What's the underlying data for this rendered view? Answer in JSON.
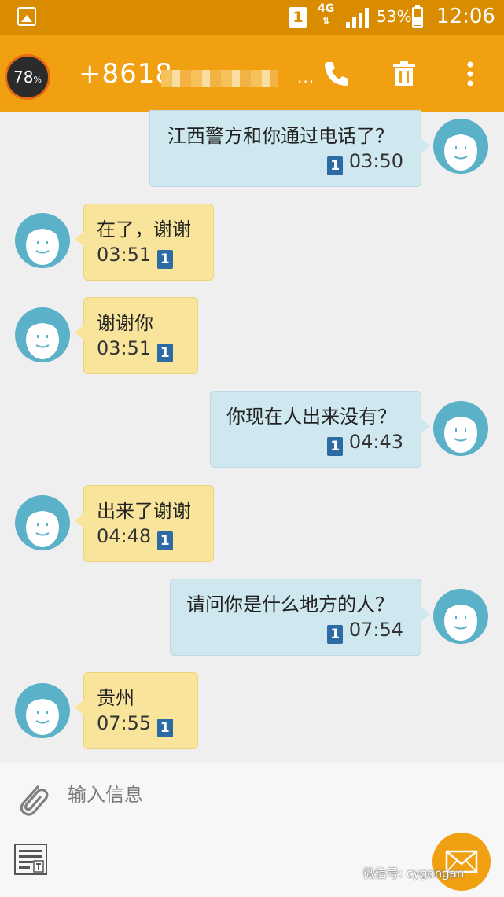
{
  "status_bar": {
    "sim_label": "1",
    "network": "4G",
    "network_arrows": "⇅",
    "battery_pct": "53%",
    "time": "12:06"
  },
  "header": {
    "badge_value": "78",
    "badge_unit": "%",
    "phone_number": "+8618",
    "phone_obscured_suffix": "...",
    "icons": [
      "phone-icon",
      "trash-icon",
      "more-icon"
    ]
  },
  "messages": [
    {
      "side": "out",
      "text": "江西警方和你通过电话了？",
      "sim": "1",
      "time": "03:50"
    },
    {
      "side": "in",
      "text": "在了，谢谢",
      "sim": "1",
      "time": "03:51"
    },
    {
      "side": "in",
      "text": "谢谢你",
      "sim": "1",
      "time": "03:51"
    },
    {
      "side": "out",
      "text": "你现在人出来没有？",
      "sim": "1",
      "time": "04:43"
    },
    {
      "side": "in",
      "text": "出来了谢谢",
      "sim": "1",
      "time": "04:48"
    },
    {
      "side": "out",
      "text": "请问你是什么地方的人？",
      "sim": "1",
      "time": "07:54"
    },
    {
      "side": "in",
      "text": "贵州",
      "sim": "1",
      "time": "07:55"
    }
  ],
  "composer": {
    "placeholder": "输入信息",
    "icons": [
      "attach-icon",
      "template-icon",
      "send-icon"
    ]
  },
  "watermark": "微信号: cygongan",
  "colors": {
    "status_bar": "#d98c00",
    "header": "#f0a010",
    "outgoing_bubble": "#cfe8f0",
    "incoming_bubble": "#f9e49c",
    "sim_badge": "#2c6ba3"
  }
}
